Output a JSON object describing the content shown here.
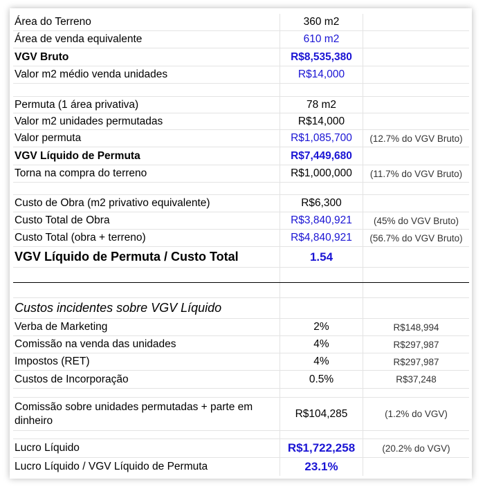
{
  "rows": [
    {
      "label": "Área do Terreno",
      "value": "360 m2",
      "note": ""
    },
    {
      "label": "Área de venda equivalente",
      "value": "610 m2",
      "note": ""
    },
    {
      "label": "VGV Bruto",
      "value": "R$8,535,380",
      "note": ""
    },
    {
      "label": "Valor m2 médio venda unidades",
      "value": "R$14,000",
      "note": ""
    },
    {
      "label": "Permuta (1 área privativa)",
      "value": "78 m2",
      "note": ""
    },
    {
      "label": "Valor m2 unidades permutadas",
      "value": "R$14,000",
      "note": ""
    },
    {
      "label": "Valor permuta",
      "value": "R$1,085,700",
      "note": "(12.7% do VGV Bruto)"
    },
    {
      "label": "VGV Líquido de Permuta",
      "value": "R$7,449,680",
      "note": ""
    },
    {
      "label": "Torna na compra do terreno",
      "value": "R$1,000,000",
      "note": "(11.7% do VGV Bruto)"
    },
    {
      "label": "Custo de Obra (m2 privativo equivalente)",
      "value": "R$6,300",
      "note": ""
    },
    {
      "label": "Custo Total de Obra",
      "value": "R$3,840,921",
      "note": "(45% do VGV Bruto)"
    },
    {
      "label": "Custo Total (obra + terreno)",
      "value": "R$4,840,921",
      "note": "(56.7% do VGV Bruto)"
    },
    {
      "label": "VGV Líquido de Permuta / Custo Total",
      "value": "1.54",
      "note": ""
    },
    {
      "label": "Custos incidentes sobre VGV Líquido",
      "value": "",
      "note": ""
    },
    {
      "label": "Verba de Marketing",
      "value": "2%",
      "note": "R$148,994"
    },
    {
      "label": "Comissão na venda das unidades",
      "value": "4%",
      "note": "R$297,987"
    },
    {
      "label": "Impostos (RET)",
      "value": "4%",
      "note": "R$297,987"
    },
    {
      "label": "Custos de Incorporação",
      "value": "0.5%",
      "note": "R$37,248"
    },
    {
      "label": "Comissão sobre unidades permutadas + parte em dinheiro",
      "value": "R$104,285",
      "note": "(1.2% do VGV)"
    },
    {
      "label": "Lucro Líquido",
      "value": "R$1,722,258",
      "note": "(20.2% do VGV)"
    },
    {
      "label": "Lucro Líquido / VGV Líquido de Permuta",
      "value": "23.1%",
      "note": ""
    }
  ],
  "colors": {
    "accent_blue": "#1a14d4",
    "grid": "#e3e3e3"
  }
}
